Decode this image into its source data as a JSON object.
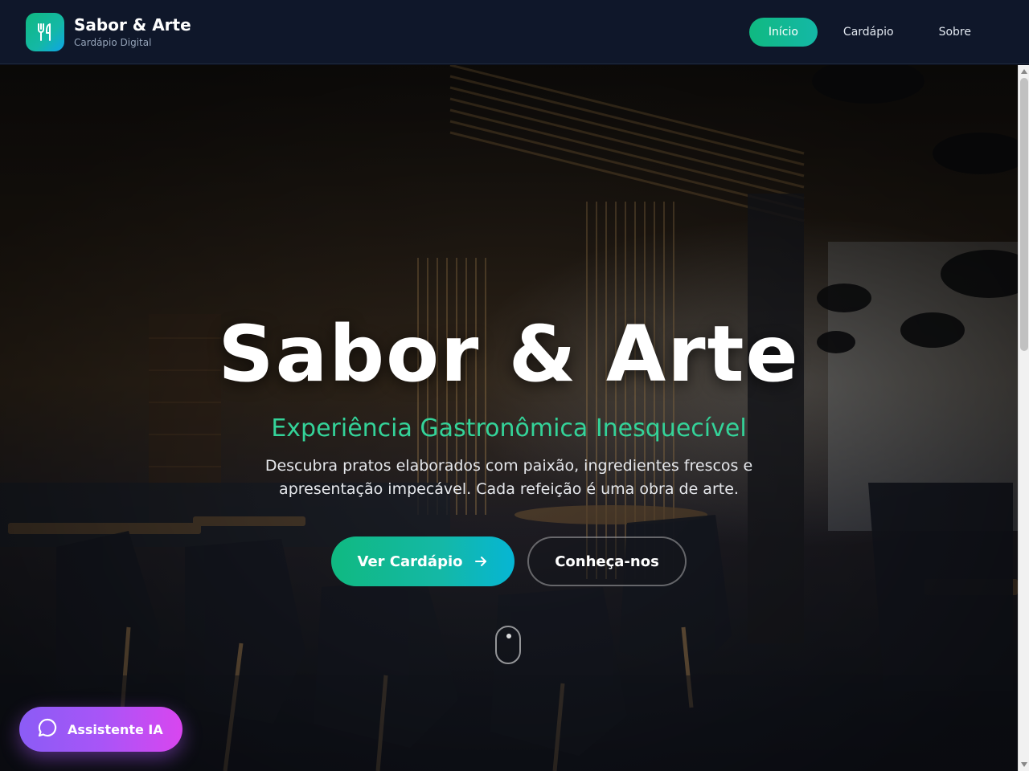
{
  "brand": {
    "name": "Sabor & Arte",
    "tagline": "Cardápio Digital",
    "icon": "utensils-icon"
  },
  "nav": {
    "items": [
      {
        "label": "Início",
        "active": true
      },
      {
        "label": "Cardápio",
        "active": false
      },
      {
        "label": "Sobre",
        "active": false
      }
    ]
  },
  "hero": {
    "title": "Sabor & Arte",
    "subtitle": "Experiência Gastronômica Inesquecível",
    "description": "Descubra pratos elaborados com paixão, ingredientes frescos e apresentação impecável. Cada refeição é uma obra de arte.",
    "primary_cta": "Ver Cardápio",
    "primary_cta_icon": "arrow-right-icon",
    "secondary_cta": "Conheça-nos",
    "background": "restaurant-interior-photo"
  },
  "assistant": {
    "label": "Assistente IA",
    "icon": "chat-bubble-icon"
  },
  "colors": {
    "accent": "#10b981",
    "accent_text": "#34d399",
    "header_bg": "#0f172a",
    "assistant_from": "#8b5cf6",
    "assistant_to": "#d946ef"
  }
}
